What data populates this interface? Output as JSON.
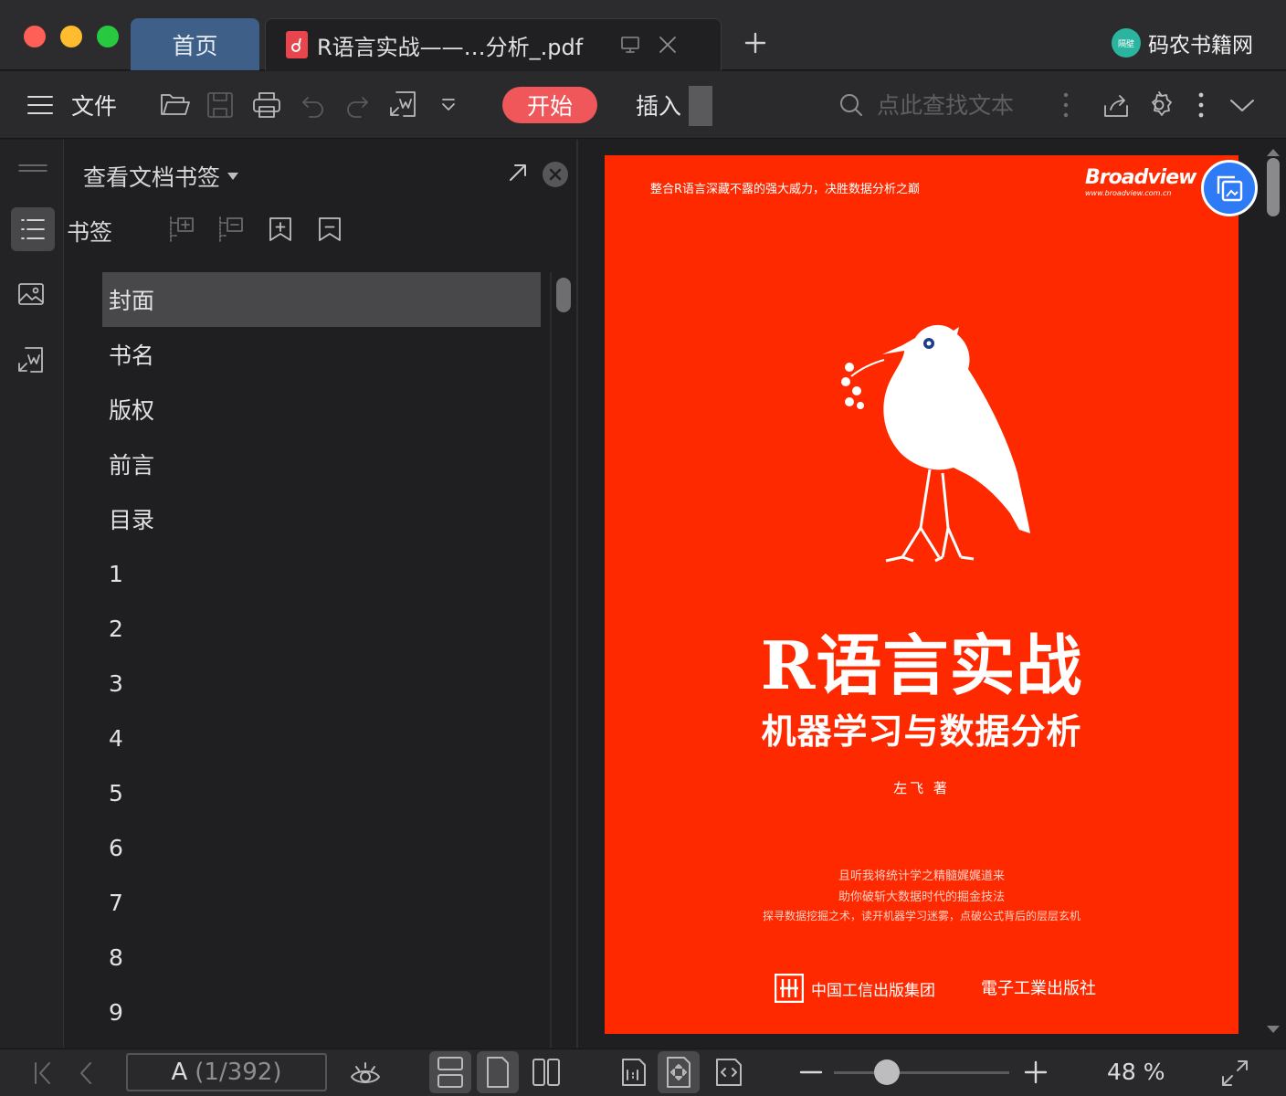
{
  "titlebar": {
    "tabs": [
      {
        "label": "首页"
      },
      {
        "label": "R语言实战——…分析_.pdf"
      }
    ],
    "brand": "码农书籍网",
    "brand_badge": "隔壁"
  },
  "toolbar": {
    "menu_label": "文件",
    "tab_start": "开始",
    "tab_insert": "插入",
    "search_placeholder": "点此查找文本"
  },
  "panel": {
    "title": "查看文档书签",
    "bookmark_label": "书签",
    "bookmarks": [
      "封面",
      "书名",
      "版权",
      "前言",
      "目录",
      "1",
      "2",
      "3",
      "4",
      "5",
      "6",
      "7",
      "8",
      "9"
    ]
  },
  "cover": {
    "tagline": "整合R语言深藏不露的强大威力，决胜数据分析之巅",
    "publisher_logo": "Broadview",
    "publisher_url": "www.broadview.com.cn",
    "title": "R语言实战",
    "subtitle": "机器学习与数据分析",
    "author": "左飞 著",
    "blurb": [
      "且听我将统计学之精髓娓娓道来",
      "助你破斩大数据时代的掘金技法",
      "探寻数据挖掘之术，读开机器学习迷雾，点破公式背后的层层玄机"
    ],
    "imprint_1": "中国工信出版集团",
    "imprint_2": "電子工業出版社"
  },
  "statusbar": {
    "page_prefix": "A",
    "page_indicator": "(1/392)",
    "zoom": "48 %",
    "zoom_fraction": 0.3
  },
  "colors": {
    "accent_tab": "#3e5f87",
    "start_tab": "#f0575a",
    "cover_red": "#ff2900",
    "float_button": "#2f7bf5"
  }
}
